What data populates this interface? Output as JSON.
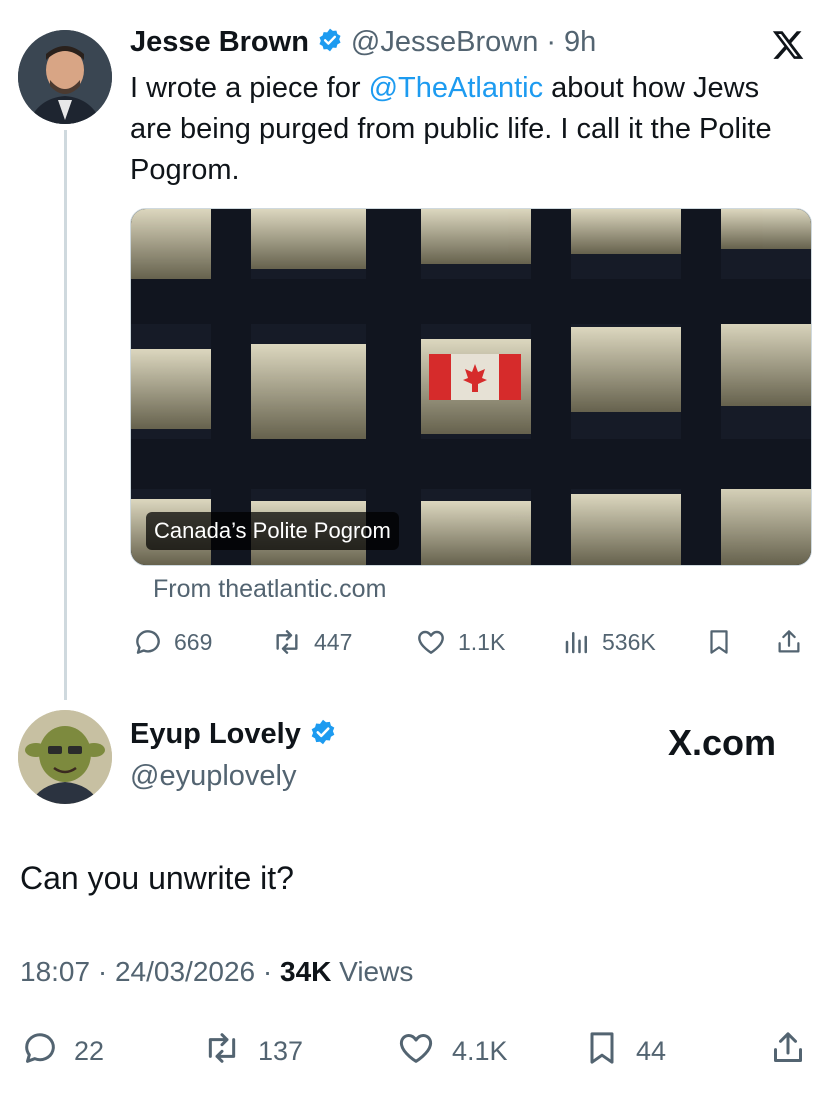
{
  "original_tweet": {
    "author_name": "Jesse Brown",
    "author_handle": "@JesseBrown",
    "time_ago": "9h",
    "text_before_mention": "I wrote a piece for ",
    "mention": "@TheAtlantic",
    "text_after_mention": " about how Jews are being purged from public life. I call it the Polite Pogrom.",
    "card_title": "Canada’s Polite Pogrom",
    "card_source": "From theatlantic.com",
    "stats": {
      "replies": "669",
      "reposts": "447",
      "likes": "1.1K",
      "views": "536K"
    }
  },
  "reply_tweet": {
    "author_name": "Eyup Lovely",
    "author_handle": "@eyuplovely",
    "watermark": "X.com",
    "text": "Can you unwrite it?",
    "time": "18:07",
    "date": "24/03/2026",
    "views_count": "34K",
    "views_label": "Views",
    "stats": {
      "replies": "22",
      "reposts": "137",
      "likes": "4.1K",
      "bookmarks": "44"
    }
  },
  "icons": [
    "verified-badge-icon",
    "x-logo-icon",
    "reply-icon",
    "repost-icon",
    "like-icon",
    "views-icon",
    "bookmark-icon",
    "share-icon"
  ],
  "colors": {
    "link": "#1d9bf0",
    "verified": "#1d9bf0",
    "secondary_text": "#536471"
  }
}
